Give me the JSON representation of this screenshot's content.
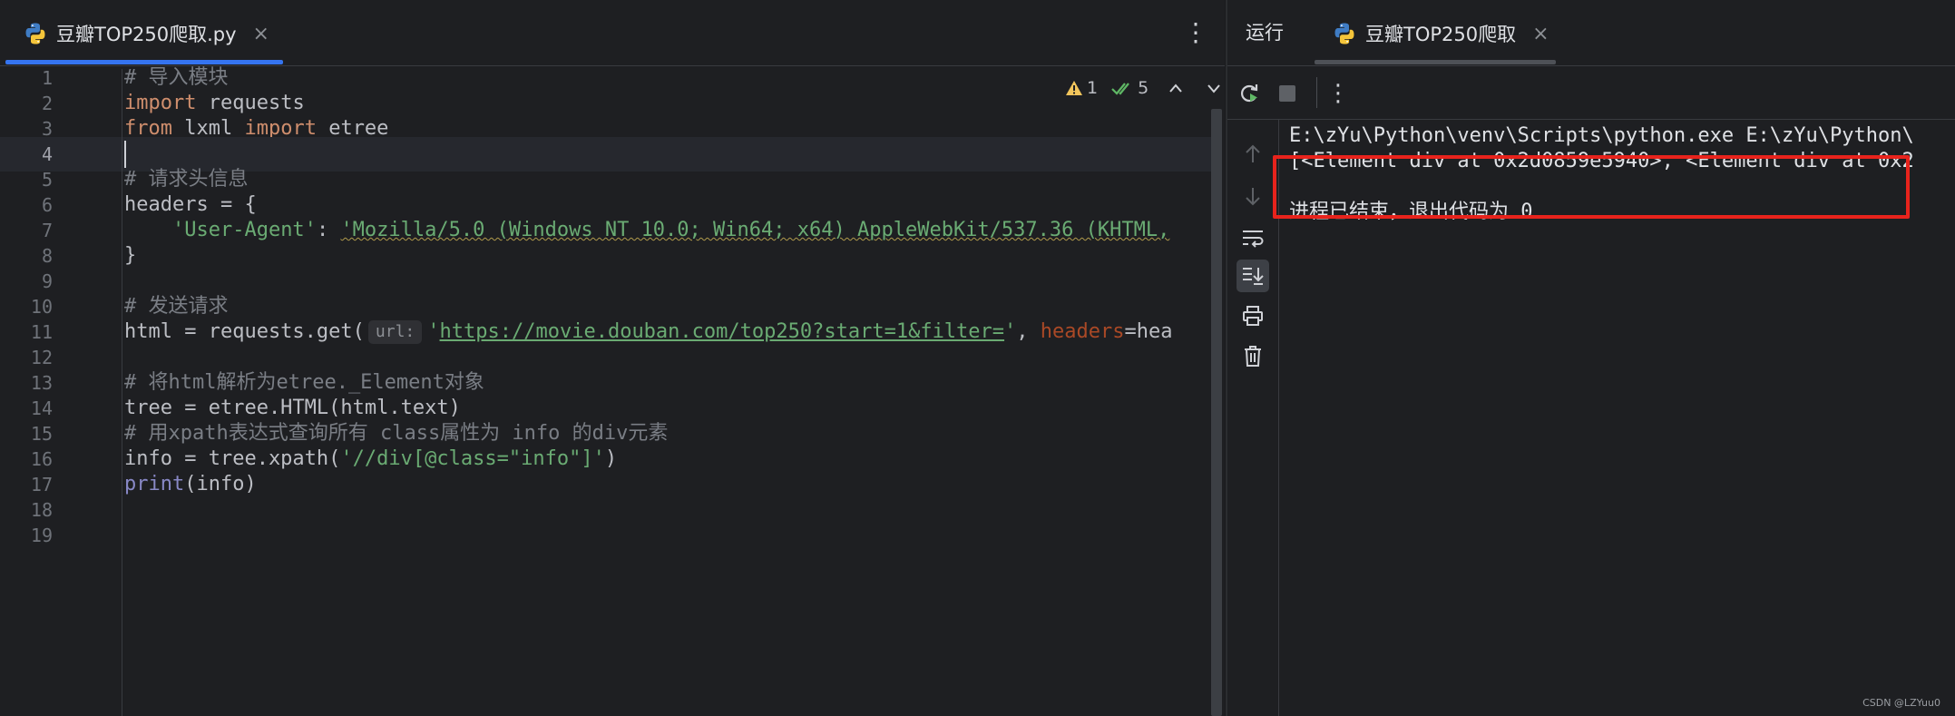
{
  "editor": {
    "tab": {
      "label": "豆瓣TOP250爬取.py",
      "close": "×"
    },
    "more_menu": "⋮",
    "inspections": {
      "warnings": "1",
      "checks": "5",
      "up": "⌃",
      "down": "⌄"
    },
    "current_line": 4,
    "lines": [
      {
        "n": "1",
        "segments": [
          {
            "t": "# 导入模块",
            "c": "cmt"
          }
        ]
      },
      {
        "n": "2",
        "segments": [
          {
            "t": "import",
            "c": "kw"
          },
          {
            "t": " requests",
            "c": ""
          }
        ]
      },
      {
        "n": "3",
        "segments": [
          {
            "t": "from",
            "c": "kw"
          },
          {
            "t": " lxml ",
            "c": ""
          },
          {
            "t": "import",
            "c": "kw"
          },
          {
            "t": " etree",
            "c": ""
          }
        ]
      },
      {
        "n": "4",
        "segments": [
          {
            "t": "",
            "c": "caret"
          }
        ]
      },
      {
        "n": "5",
        "segments": [
          {
            "t": "# 请求头信息",
            "c": "cmt"
          }
        ]
      },
      {
        "n": "6",
        "segments": [
          {
            "t": "headers = {",
            "c": ""
          }
        ]
      },
      {
        "n": "7",
        "segments": [
          {
            "t": "    ",
            "c": ""
          },
          {
            "t": "'User-Agent'",
            "c": "str"
          },
          {
            "t": ": ",
            "c": ""
          },
          {
            "t": "'Mozilla/5.0 (Windows NT 10.0; Win64; x64) AppleWebKit/537.36 (KHTML,",
            "c": "str squiggle"
          }
        ]
      },
      {
        "n": "8",
        "segments": [
          {
            "t": "}",
            "c": ""
          }
        ]
      },
      {
        "n": "9",
        "segments": []
      },
      {
        "n": "10",
        "segments": [
          {
            "t": "# 发送请求",
            "c": "cmt"
          }
        ]
      },
      {
        "n": "11",
        "segments": [
          {
            "t": "html = requests.get(",
            "c": ""
          },
          {
            "t": "url:",
            "c": "hint"
          },
          {
            "t": "'",
            "c": "str"
          },
          {
            "t": "https://movie.douban.com/top250?start=1&filter=",
            "c": "url"
          },
          {
            "t": "'",
            "c": "str"
          },
          {
            "t": ", ",
            "c": ""
          },
          {
            "t": "headers",
            "c": "param"
          },
          {
            "t": "=hea",
            "c": ""
          }
        ]
      },
      {
        "n": "12",
        "segments": []
      },
      {
        "n": "13",
        "segments": [
          {
            "t": "# 将html解析为etree._Element对象",
            "c": "cmt"
          }
        ]
      },
      {
        "n": "14",
        "segments": [
          {
            "t": "tree = etree.HTML(html.text)",
            "c": ""
          }
        ]
      },
      {
        "n": "15",
        "segments": [
          {
            "t": "# 用xpath表达式查询所有 class属性为 info 的div元素",
            "c": "cmt"
          }
        ]
      },
      {
        "n": "16",
        "segments": [
          {
            "t": "info = tree.xpath(",
            "c": ""
          },
          {
            "t": "'//div[@class=\"info\"]'",
            "c": "str"
          },
          {
            "t": ")",
            "c": ""
          }
        ]
      },
      {
        "n": "17",
        "segments": [
          {
            "t": "print",
            "c": "builtin"
          },
          {
            "t": "(info)",
            "c": ""
          }
        ]
      },
      {
        "n": "18",
        "segments": []
      },
      {
        "n": "19",
        "segments": []
      }
    ]
  },
  "run": {
    "title": "运行",
    "tab": {
      "label": "豆瓣TOP250爬取",
      "close": "×"
    },
    "toolbar_more": "⋮",
    "console": [
      "E:\\zYu\\Python\\venv\\Scripts\\python.exe E:\\zYu\\Python\\",
      "[<Element div at 0x2d0859e5940>, <Element div at 0x2",
      "",
      "进程已结束，退出代码为 0"
    ]
  },
  "watermark": "CSDN @LZYuu0",
  "colors": {
    "accent": "#3574f0",
    "highlight": "#e8231c",
    "background": "#1e1f22"
  }
}
